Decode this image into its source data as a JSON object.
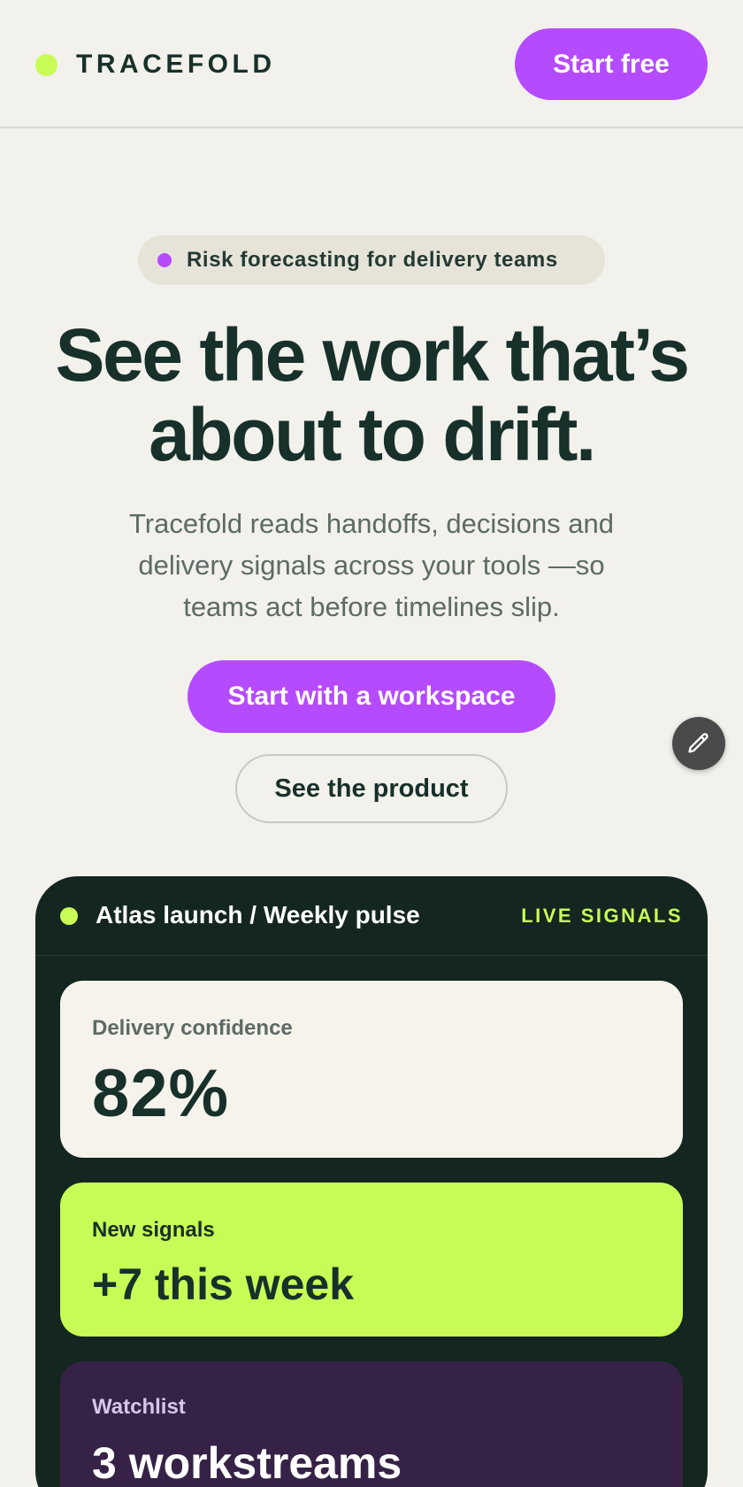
{
  "header": {
    "brand_name": "TRACEFOLD",
    "cta_label": "Start free"
  },
  "hero": {
    "eyebrow": "Risk forecasting for delivery teams",
    "headline_line1": "See the work that’s",
    "headline_line2": "about to drift.",
    "subcopy": "Tracefold reads handoffs, decisions and delivery signals across your tools —so teams act before timelines slip.",
    "primary_cta": "Start with a workspace",
    "secondary_cta": "See the product"
  },
  "edit_button": {
    "icon": "pencil-icon"
  },
  "dashboard": {
    "title": "Atlas launch / Weekly pulse",
    "status": "LIVE SIGNALS",
    "tiles": [
      {
        "label": "Delivery confidence",
        "value": "82%"
      },
      {
        "label": "New signals",
        "value": "+7 this week"
      },
      {
        "label": "Watchlist",
        "value": "3 workstreams"
      }
    ]
  },
  "colors": {
    "accent_purple": "#b54bff",
    "accent_lime": "#c9fb56",
    "ink": "#18302a",
    "background": "#f2f1ec",
    "dashboard_bg": "#13261f",
    "watchlist_bg": "#362246"
  }
}
